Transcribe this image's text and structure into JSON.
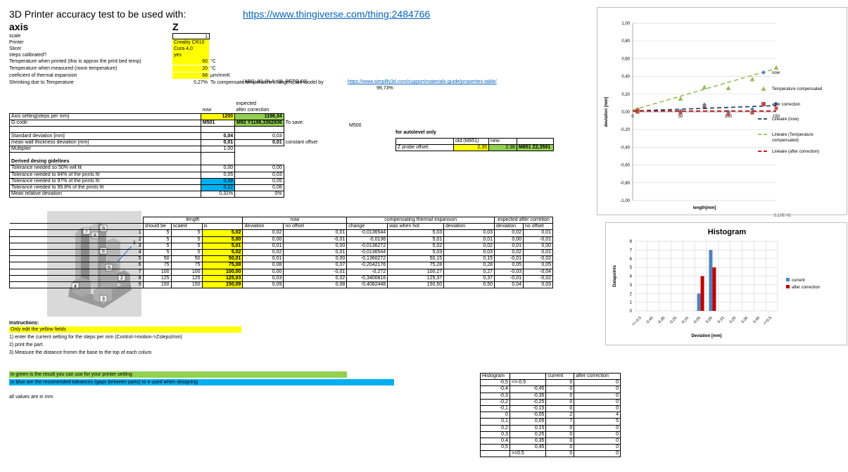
{
  "title": "3D Printer accuracy test to be used with:",
  "url": "https://www.thingiverse.com/thing:2484766",
  "axis_label": "axis",
  "axis_value": "Z",
  "params": [
    {
      "label": "scale",
      "value": "1",
      "unit": "",
      "style": ""
    },
    {
      "label": "Printer",
      "value": "Creality CR10",
      "unit": "",
      "style": "y"
    },
    {
      "label": "Slicer",
      "value": "Cura 4,0",
      "unit": "",
      "style": "y"
    },
    {
      "label": "steps calibrated?",
      "value": "yes",
      "unit": "",
      "style": "y"
    },
    {
      "label": "Temperature when printed (this is approx the print bed temp)",
      "value": "60",
      "unit": "°C",
      "style": "y"
    },
    {
      "label": "Temperature when measured (room temperature)",
      "value": "20",
      "unit": "°C",
      "style": "y"
    },
    {
      "label": "coeficient of thermal expansion",
      "value": "68",
      "unit": "µm/mmK",
      "style": "y"
    },
    {
      "label": "Shrinking due to Temperature",
      "value": "0,27%",
      "unit": "To compensate temperature change scale model by",
      "style": ""
    }
  ],
  "abs_note": "(ABS: 90, PLA: 68, PETG 60)",
  "scale_pct": "99,73%",
  "link2": "https://www.simplify3d.com/support/materials-guide/properties-table/",
  "mid": {
    "h_expected": "expected",
    "h_now": "now",
    "h_after": "after correction",
    "axis_label": "Axis setting[steps per mm]",
    "axis_now": "1200",
    "axis_after": "1196,34",
    "gcode_label": "G-code",
    "gcode_now": "M501",
    "gcode_after": "M92 Y1196,3362936",
    "to_save": "To save:",
    "m500": "M500",
    "std_label": "Standard deviation [mm]",
    "std_now": "0,04",
    "std_after": "0,03",
    "wall_label": "mean wall thickness deviation [mm]",
    "wall_now": "0,01",
    "wall_after": "0,01",
    "wall_note": "constant offset",
    "mult_label": "Multiplier",
    "mult_now": "1,00",
    "derived": "Derived desing gidelines",
    "tol": [
      {
        "label": "Tolerance needed so 50% will fit",
        "now": "0,00",
        "after": "0,00",
        "style": ""
      },
      {
        "label": "Tolerance needed to 84% of the prints fit",
        "now": "0,05",
        "after": "0,03",
        "style": ""
      },
      {
        "label": "Tolerance needed to 97% of the prints fit",
        "now": "0,08",
        "after": "0,05",
        "style": "bl"
      },
      {
        "label": "Tolerance needed to 99.8% of the prints fit",
        "now": "0,12",
        "after": "0,08",
        "style": "bl"
      }
    ],
    "mrd_label": "Mean relative deviation",
    "mrd_now": "0,31%",
    "mrd_after": "0%"
  },
  "autolevel": {
    "title": "for autolevel only",
    "h_old": "old (M851)",
    "h_new": "new",
    "label": "Z probe offset:",
    "old": "2,35",
    "new": "2,36",
    "cmd": "M851 Z2,3591"
  },
  "main": {
    "h_length": "length",
    "h_now": "now",
    "h_comp": "compensating thermal expansion",
    "h_exp": "expected after corretion",
    "sub": [
      "should be",
      "scaled",
      "is",
      "deviation",
      "no offset",
      "change",
      "was when hot",
      "deviation",
      "deviation",
      "no offset"
    ],
    "rows": [
      [
        "1",
        "5",
        "5",
        "5,02",
        "0,02",
        "0,01",
        "-0,0136544",
        "5,03",
        "0,03",
        "0,02",
        "0,01"
      ],
      [
        "2",
        "5",
        "5",
        "5,00",
        "0,00",
        "-0,01",
        "-0,0136",
        "5,01",
        "0,01",
        "0,00",
        "-0,01"
      ],
      [
        "3",
        "5",
        "5",
        "5,01",
        "0,01",
        "0,00",
        "-0,0136272",
        "5,02",
        "0,02",
        "0,01",
        "0,00"
      ],
      [
        "4",
        "5",
        "5",
        "5,02",
        "0,02",
        "0,01",
        "-0,0136544",
        "5,03",
        "0,03",
        "0,02",
        "0,01"
      ],
      [
        "5",
        "50",
        "50",
        "50,01",
        "0,01",
        "0,00",
        "-0,1360272",
        "50,15",
        "0,15",
        "-0,01",
        "-0,02"
      ],
      [
        "6",
        "75",
        "75",
        "75,08",
        "0,08",
        "0,07",
        "-0,2042176",
        "75,28",
        "0,28",
        "0,05",
        "0,05"
      ],
      [
        "7",
        "100",
        "100",
        "100,00",
        "0,00",
        "-0,01",
        "-0,272",
        "100,27",
        "0,27",
        "-0,03",
        "-0,04"
      ],
      [
        "8",
        "125",
        "125",
        "125,03",
        "0,03",
        "0,02",
        "-0,3400816",
        "125,37",
        "0,37",
        "-0,01",
        "-0,02"
      ],
      [
        "9",
        "150",
        "150",
        "150,09",
        "0,09",
        "0,08",
        "-0,4082448",
        "150,50",
        "0,50",
        "0,04",
        "0,03"
      ]
    ]
  },
  "instructions": {
    "title": "Instructions:",
    "only": "Only edit the yellow fields",
    "steps": [
      "1) enter the current setting for the steps per mm (Control->motion->Zsteps/mm)",
      "2) print the part",
      "3) Measure the distance fromm the base to the top of each colum"
    ]
  },
  "notes": {
    "green": "in green is the result you can use for your printer setting",
    "blue": "in blue are the recomended toleances (gaps between parts) to e used when designing",
    "mm": "all values are in mm"
  },
  "model": {
    "labels": [
      "9",
      "7",
      "8",
      "6",
      "5",
      "4",
      "2",
      "3",
      "1"
    ]
  },
  "hist_table": {
    "headers": [
      "Histogram",
      "",
      "current",
      "after correction"
    ],
    "rows": [
      [
        "-0,5",
        "<=-0.5",
        "0",
        "0"
      ],
      [
        "-0,4",
        "-0,45",
        "0",
        "0"
      ],
      [
        "-0,3",
        "-0,35",
        "0",
        "0"
      ],
      [
        "-0,2",
        "-0,25",
        "0",
        "0"
      ],
      [
        "-0,1",
        "-0,15",
        "0",
        "0"
      ],
      [
        "0",
        "-0,05",
        "2",
        "4"
      ],
      [
        "0,1",
        "0,05",
        "7",
        "5"
      ],
      [
        "0,2",
        "0,15",
        "0",
        "0"
      ],
      [
        "0,3",
        "0,25",
        "0",
        "0"
      ],
      [
        "0,4",
        "0,35",
        "0",
        "0"
      ],
      [
        "0,5",
        "0,45",
        "0",
        "0"
      ],
      [
        "",
        ">=0.5",
        "0",
        "0"
      ]
    ]
  },
  "chart_data": [
    {
      "type": "scatter",
      "xlabel": "length[mm]",
      "ylabel": "deviation [mm]",
      "ylim": [
        -1,
        1
      ],
      "xlim": [
        0,
        150
      ],
      "yticks": [
        "1,00",
        "0,80",
        "0,60",
        "0,40",
        "0,20",
        "0,00",
        "-0,20",
        "-0,40",
        "-0,60",
        "-0,80",
        "-1,00"
      ],
      "xticks": [
        "0",
        "50",
        "100",
        "150"
      ],
      "footnote": "5,10E-01",
      "series": [
        {
          "name": "now",
          "marker": "diamond",
          "color": "#4f81bd",
          "points": [
            [
              5,
              0.02
            ],
            [
              5,
              0.0
            ],
            [
              5,
              0.01
            ],
            [
              5,
              0.02
            ],
            [
              50,
              0.01
            ],
            [
              75,
              0.08
            ],
            [
              100,
              0.0
            ],
            [
              125,
              0.03
            ],
            [
              150,
              0.09
            ]
          ]
        },
        {
          "name": "Temperature compensated",
          "marker": "triangle",
          "color": "#9bbb59",
          "points": [
            [
              5,
              0.03
            ],
            [
              5,
              0.01
            ],
            [
              5,
              0.02
            ],
            [
              5,
              0.03
            ],
            [
              50,
              0.15
            ],
            [
              75,
              0.28
            ],
            [
              100,
              0.27
            ],
            [
              125,
              0.37
            ],
            [
              150,
              0.5
            ]
          ]
        },
        {
          "name": "after correction",
          "marker": "square",
          "color": "#c0504d",
          "points": [
            [
              5,
              0.02
            ],
            [
              5,
              0.0
            ],
            [
              5,
              0.01
            ],
            [
              5,
              0.02
            ],
            [
              50,
              -0.01
            ],
            [
              75,
              0.05
            ],
            [
              100,
              -0.03
            ],
            [
              125,
              -0.01
            ],
            [
              150,
              0.04
            ]
          ]
        },
        {
          "name": "Linéaire (now)",
          "trend": [
            [
              0,
              0.01
            ],
            [
              150,
              0.07
            ]
          ],
          "color": "#1f3864",
          "dash": "6,4"
        },
        {
          "name": "Linéaire (Temperature compensated)",
          "trend": [
            [
              0,
              0.02
            ],
            [
              150,
              0.49
            ]
          ],
          "color": "#9bbb59",
          "dash": "6,4"
        },
        {
          "name": "Linéaire (after correction)",
          "trend": [
            [
              0,
              0.01
            ],
            [
              150,
              0.01
            ]
          ],
          "color": "#c00000",
          "dash": "6,4"
        }
      ]
    },
    {
      "type": "bar",
      "title": "Histogram",
      "xlabel": "Deviation [mm]",
      "ylabel": "Datapoints",
      "ylim": [
        0,
        8
      ],
      "categories": [
        "<=-0.5",
        "-0,45",
        "-0,35",
        "-0,25",
        "-0,15",
        "-0,05",
        "0,05",
        "0,15",
        "0,25",
        "0,35",
        "0,45",
        ">=0.5"
      ],
      "series": [
        {
          "name": "current",
          "color": "#4f81bd",
          "values": [
            0,
            0,
            0,
            0,
            0,
            2,
            7,
            0,
            0,
            0,
            0,
            0
          ]
        },
        {
          "name": "after correction",
          "color": "#c00000",
          "values": [
            0,
            0,
            0,
            0,
            0,
            4,
            5,
            0,
            0,
            0,
            0,
            0
          ]
        }
      ]
    }
  ]
}
